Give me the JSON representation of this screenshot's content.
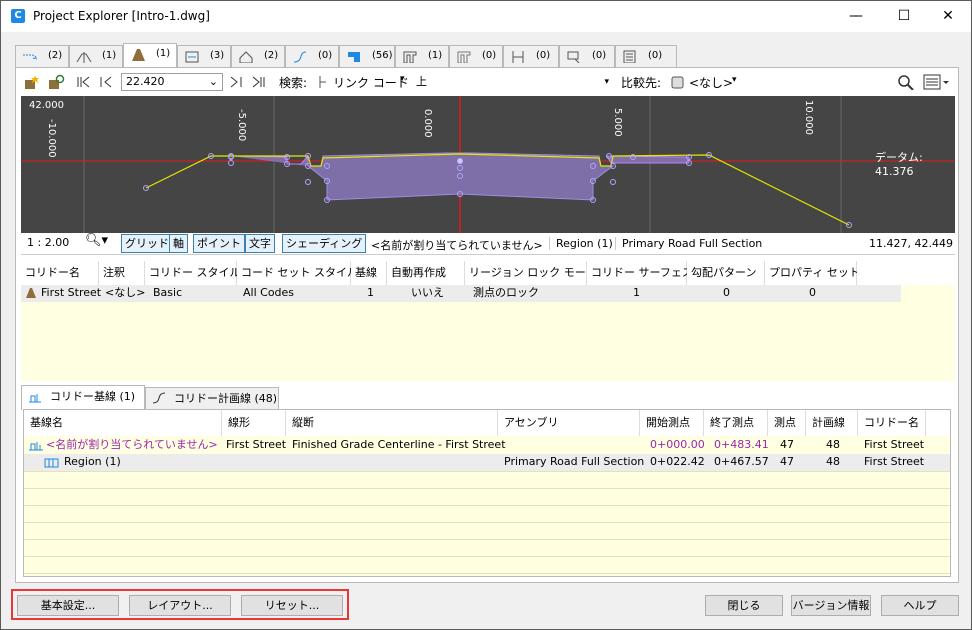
{
  "window": {
    "title": "Project Explorer [Intro-1.dwg]",
    "minimize": "—",
    "maximize": "☐",
    "close": "✕"
  },
  "tabs": [
    {
      "count": "(2)"
    },
    {
      "count": "(1)"
    },
    {
      "count": "(1)"
    },
    {
      "count": "(3)"
    },
    {
      "count": "(2)"
    },
    {
      "count": "(0)"
    },
    {
      "count": "(56)"
    },
    {
      "count": "(1)"
    },
    {
      "count": "(0)"
    },
    {
      "count": "(0)"
    },
    {
      "count": "(0)"
    },
    {
      "count": "(0)"
    }
  ],
  "toolbar": {
    "station": "22.420",
    "search_label": "検索:",
    "search_field": "リンク コード",
    "search_value": "上",
    "compare_label": "比較先:",
    "compare_value": "<なし>"
  },
  "view": {
    "y_value": "42.000",
    "ticks": [
      "-10.000",
      "-5.000",
      "0.000",
      "5.000",
      "10.000"
    ],
    "datum": "データム: 41.376"
  },
  "statusbar": {
    "scale": "1 : 2.00",
    "grid": "グリッド",
    "axis": "軸",
    "point": "ポイント",
    "text": "文字",
    "shading": "シェーディング",
    "baseline": "<名前が割り当てられていません>",
    "region": "Region (1)",
    "assembly": "Primary Road Full Section",
    "coords": "11.427, 42.449"
  },
  "corridor_table": {
    "headers": [
      "コリドー名",
      "注釈",
      "コリドー スタイル",
      "コード セット スタイル",
      "基線",
      "自動再作成",
      "リージョン ロック モード",
      "コリドー サーフェス",
      "勾配パターン",
      "プロパティ セット"
    ],
    "rows": [
      {
        "name": "First Street",
        "note": "<なし>",
        "style": "Basic",
        "code_set": "All Codes",
        "baseline": "1",
        "rebuild": "いいえ",
        "lock": "測点のロック",
        "surface": "1",
        "slope": "0",
        "props": "0"
      }
    ]
  },
  "bottom_tabs": {
    "baselines": "コリドー基線 (1)",
    "featurelines": "コリドー計画線 (48)"
  },
  "baseline_table": {
    "headers": [
      "基線名",
      "線形",
      "縦断",
      "アセンブリ",
      "開始測点",
      "終了測点",
      "測点",
      "計画線",
      "コリドー名"
    ],
    "rows": [
      {
        "name": "<名前が割り当てられていません>",
        "alignment": "First Street",
        "profile": "Finished Grade Centerline - First Street",
        "assembly": "",
        "start": "0+000.00",
        "end": "0+483.41",
        "stations": "47",
        "flines": "48",
        "corridor": "First Street"
      },
      {
        "name": "Region (1)",
        "alignment": "",
        "profile": "",
        "assembly": "Primary Road Full Section",
        "start": "0+022.42",
        "end": "0+467.57",
        "stations": "47",
        "flines": "48",
        "corridor": "First Street"
      }
    ]
  },
  "buttons": {
    "settings": "基本設定...",
    "layout": "レイアウト...",
    "reset": "リセット...",
    "close": "閉じる",
    "version": "バージョン情報",
    "help": "ヘルプ"
  },
  "colors": {
    "accent": "#1e88e5",
    "highlight_box": "#e53935",
    "grid_bg": "#ffffe1",
    "view_bg": "#454545",
    "surface_line": "#ffff00",
    "shade_fill": "#7e6fa8"
  }
}
